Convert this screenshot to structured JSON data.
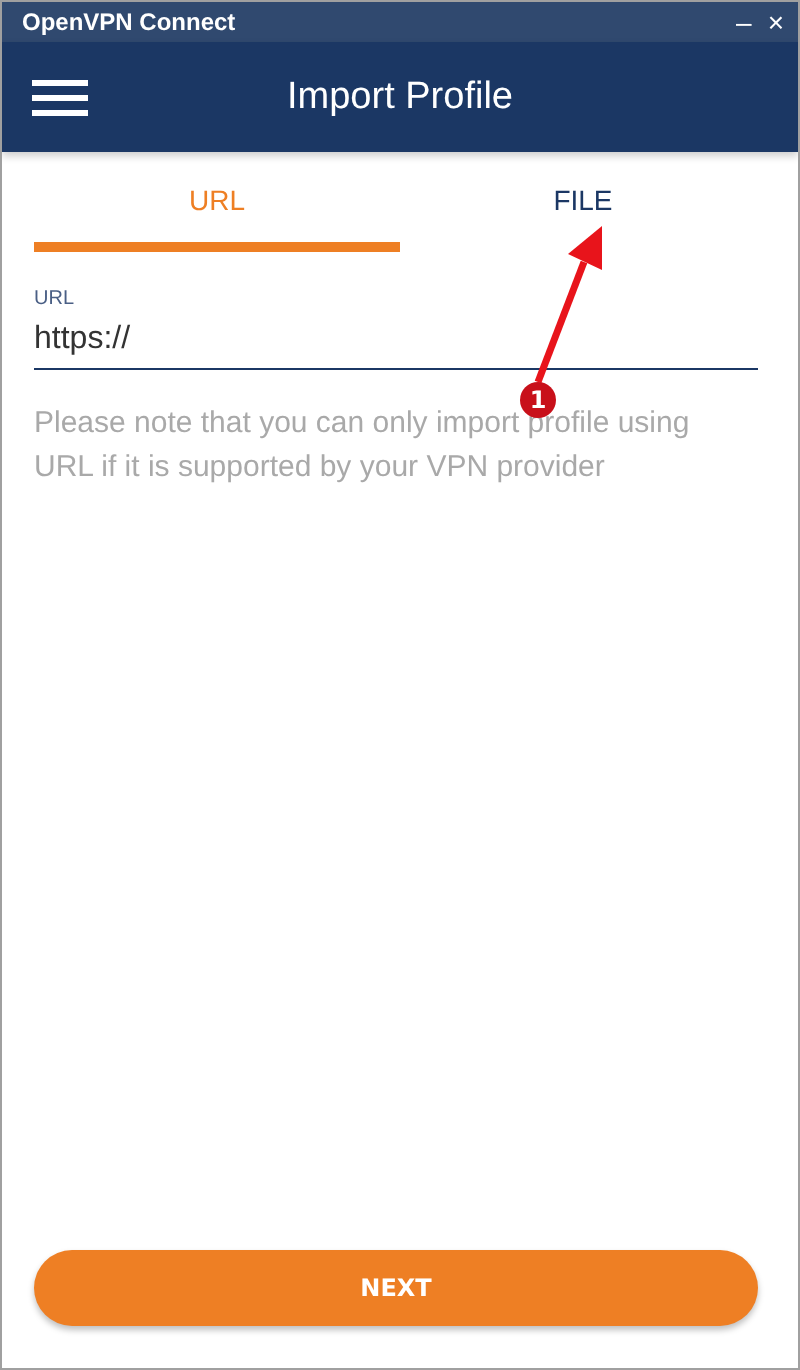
{
  "window": {
    "title": "OpenVPN Connect",
    "controls": [
      "–",
      "×"
    ]
  },
  "header": {
    "title": "Import Profile"
  },
  "tabs": [
    {
      "label": "URL",
      "selected": true
    },
    {
      "label": "FILE",
      "selected": false
    }
  ],
  "url_field": {
    "label": "URL",
    "value": "https://"
  },
  "note": "Please note that you can only import profile using URL if it is supported by your VPN provider",
  "next_button": "NEXT",
  "annotation": {
    "label": "1"
  }
}
